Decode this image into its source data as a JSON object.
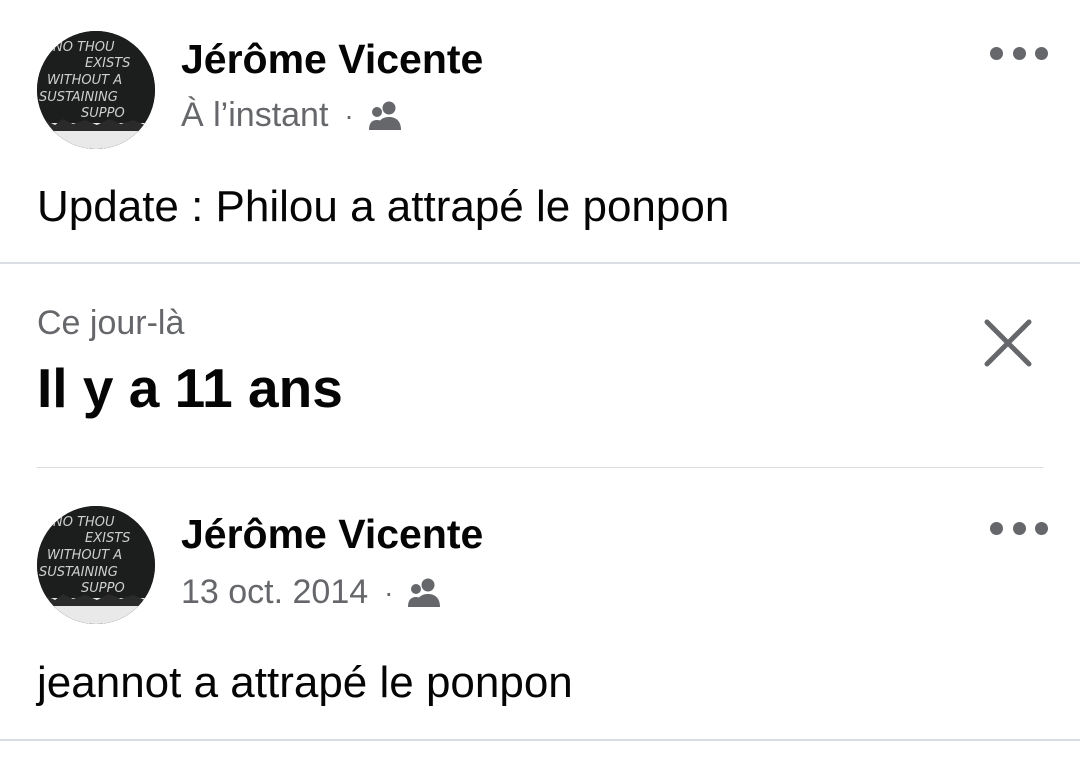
{
  "posts": [
    {
      "author": "Jérôme Vicente",
      "time": "À l’instant",
      "separator": "·",
      "audience_icon": "friends-icon",
      "text": "Update : Philou a attrapé le ponpon",
      "avatar_text": [
        "NO THOU",
        "EXISTS",
        "WITHOUT A",
        "SUSTAINING",
        "SUPPO"
      ]
    },
    {
      "author": "Jérôme Vicente",
      "time": "13 oct. 2014",
      "separator": "·",
      "audience_icon": "friends-icon",
      "text": "jeannot a attrapé le ponpon",
      "avatar_text": [
        "NO THOU",
        "EXISTS",
        "WITHOUT A",
        "SUSTAINING",
        "SUPPO"
      ]
    }
  ],
  "memories": {
    "subtitle": "Ce jour-là",
    "title": "Il y a 11 ans",
    "close_icon": "close-icon"
  },
  "colors": {
    "text_primary": "#050505",
    "text_secondary": "#65676b",
    "divider": "#dadde1",
    "avatar_bg": "#1c1d1d"
  }
}
